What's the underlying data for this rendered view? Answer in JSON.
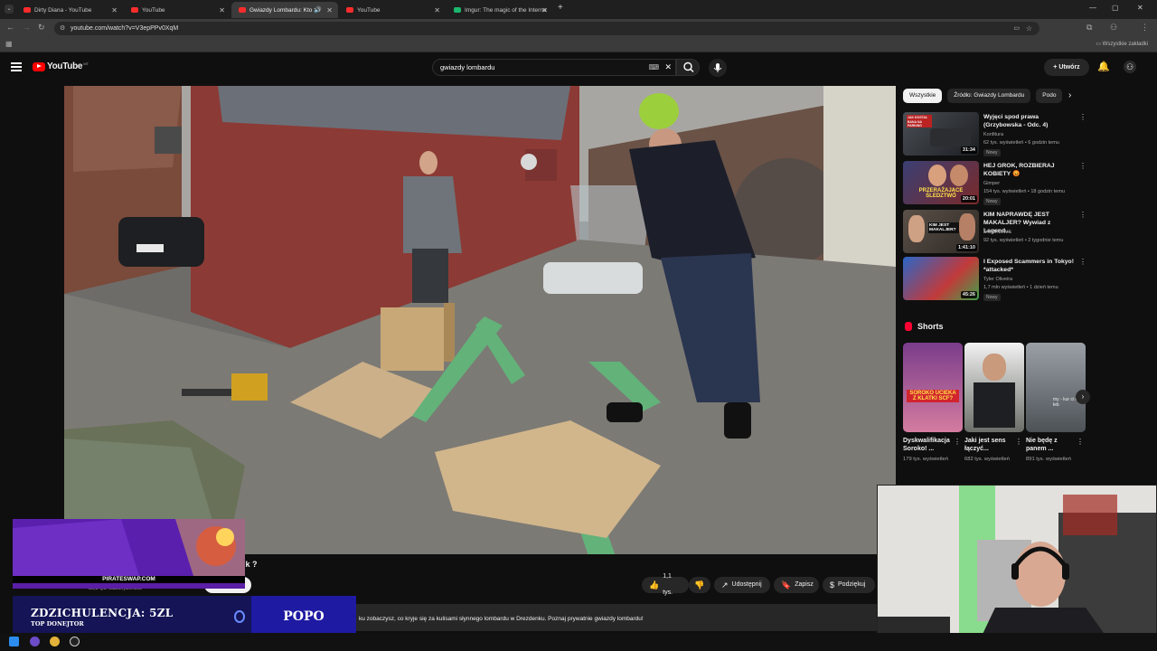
{
  "browser": {
    "tabs": [
      {
        "title": "Dirty Diana - YouTube",
        "icon": "youtube-favicon"
      },
      {
        "title": "YouTube",
        "icon": "youtube-favicon"
      },
      {
        "title": "Gwiazdy Lombardu: Kto zb",
        "icon": "youtube-favicon",
        "active": true
      },
      {
        "title": "YouTube",
        "icon": "youtube-favicon"
      },
      {
        "title": "Imgur: The magic of the Interne",
        "icon": "imgur-favicon"
      }
    ],
    "url": "youtube.com/watch?v=V3epPPv0XqM",
    "bookmarks_folder": "Wszystkie zakładki"
  },
  "youtube": {
    "logo_text": "YouTube",
    "logo_country": "MT",
    "search_value": "gwiazdy lombardu",
    "create_label": "Utwórz"
  },
  "video": {
    "title_tail": "nnik ?",
    "subs": "30,2 tys. subskrybentów",
    "actions": {
      "likes": "1,1 tys.",
      "share": "Udostępnij",
      "save": "Zapisz",
      "thanks": "Podziękuj"
    },
    "description": "ku zobaczysz, co kryje się za kulisami słynnego lombardu w Drezdenku. Poznaj prywatnie gwiazdy lombardu!"
  },
  "sidebar": {
    "chips": [
      "Wszystkie",
      "Źródło: Gwiazdy Lombardu",
      "Podo"
    ],
    "recommendations": [
      {
        "title": "Wyjęci spod prawa (Grzybowska - Odc. 4)",
        "channel": "Konfitura",
        "meta": "62 tys. wyświetleń • 6 godzin temu",
        "badge": "Nowy",
        "duration": "31:34",
        "thumb_text": "JAK DOSTAŁ BANA NA PARKING"
      },
      {
        "title": "HEJ GROK, ROZBIERAJ KOBIETY 😡",
        "channel": "Gimper",
        "meta": "154 tys. wyświetleń • 18 godzin temu",
        "badge": "Nowy",
        "duration": "20:01",
        "thumb_text": "PRZERAŻAJĄCE ŚLEDZTWO"
      },
      {
        "title": "KIM NAPRAWDĘ JEST MAKALJER? Wywiad z Legend...",
        "channel": "DOMINEWS",
        "meta": "92 tys. wyświetleń • 2 tygodnie temu",
        "badge": "",
        "duration": "1:41:10",
        "thumb_text": "KIM JEST MAKALJER?"
      },
      {
        "title": "I Exposed Scammers in Tokyo! *attacked*",
        "channel": "Tyler Oliveira",
        "meta": "1,7 mln wyświetleń • 1 dzień temu",
        "badge": "Nowy",
        "duration": "45:26",
        "thumb_text": ""
      }
    ],
    "shorts_label": "Shorts",
    "shorts": [
      {
        "title": "Dyskwalifikacja Soroko! ...",
        "views": "179 tys. wyświetleń",
        "thumb_text": "SOROKO UCIEKA Z KLATKI SCF?"
      },
      {
        "title": "Jaki jest sens łączyć...",
        "views": "682 tys. wyświetleń",
        "thumb_text": ""
      },
      {
        "title": "Nie będę z panem ...",
        "views": "891 tys. wyświetleń",
        "thumb_text": "my - kur ci na łeb"
      }
    ]
  },
  "overlays": {
    "ad_domain": "PIRATESWAP.COM",
    "donation_amount": "ZDZICHULENCJA: 5ZL",
    "donation_label": "TOP DONEJTOR",
    "donor_name": "POPO"
  },
  "colors": {
    "accent_red": "#ff0000",
    "background": "#0f0f0f",
    "donor_panel": "#141456",
    "donor_name_bg": "#1e1aa2"
  }
}
